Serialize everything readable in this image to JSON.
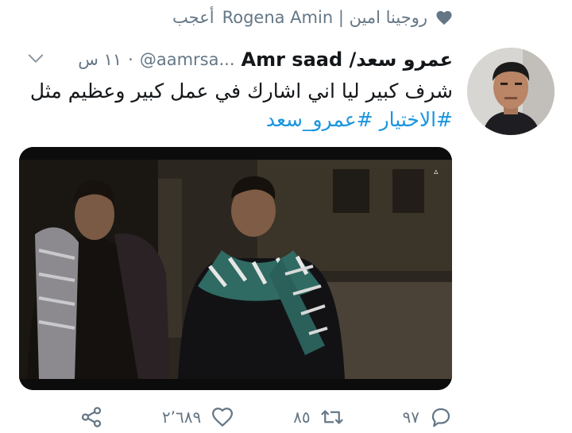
{
  "liked_by": {
    "name": "روجينا امين | Rogena Amin",
    "verb": "أعجب"
  },
  "tweet": {
    "display_name": "عمرو سعد/ Amr saad",
    "handle": "@aamrsa...",
    "separator": "·",
    "time": "١١ س",
    "text_line": "شرف كبير ليا اني اشارك في عمل كبير وعظيم مثل",
    "hashtags": "#الاختيار #عمرو_سعد"
  },
  "media": {
    "badge": "▵"
  },
  "actions": {
    "reply_count": "٩٧",
    "retweet_count": "٨٥",
    "like_count": "٢٬٦٨٩"
  },
  "icons": {
    "heart": "heart-icon",
    "caret": "chevron-down-icon",
    "reply": "reply-icon",
    "retweet": "retweet-icon",
    "like": "like-icon",
    "share": "share-icon"
  },
  "colors": {
    "text": "#14171a",
    "muted": "#657786",
    "link": "#1b95e0"
  }
}
